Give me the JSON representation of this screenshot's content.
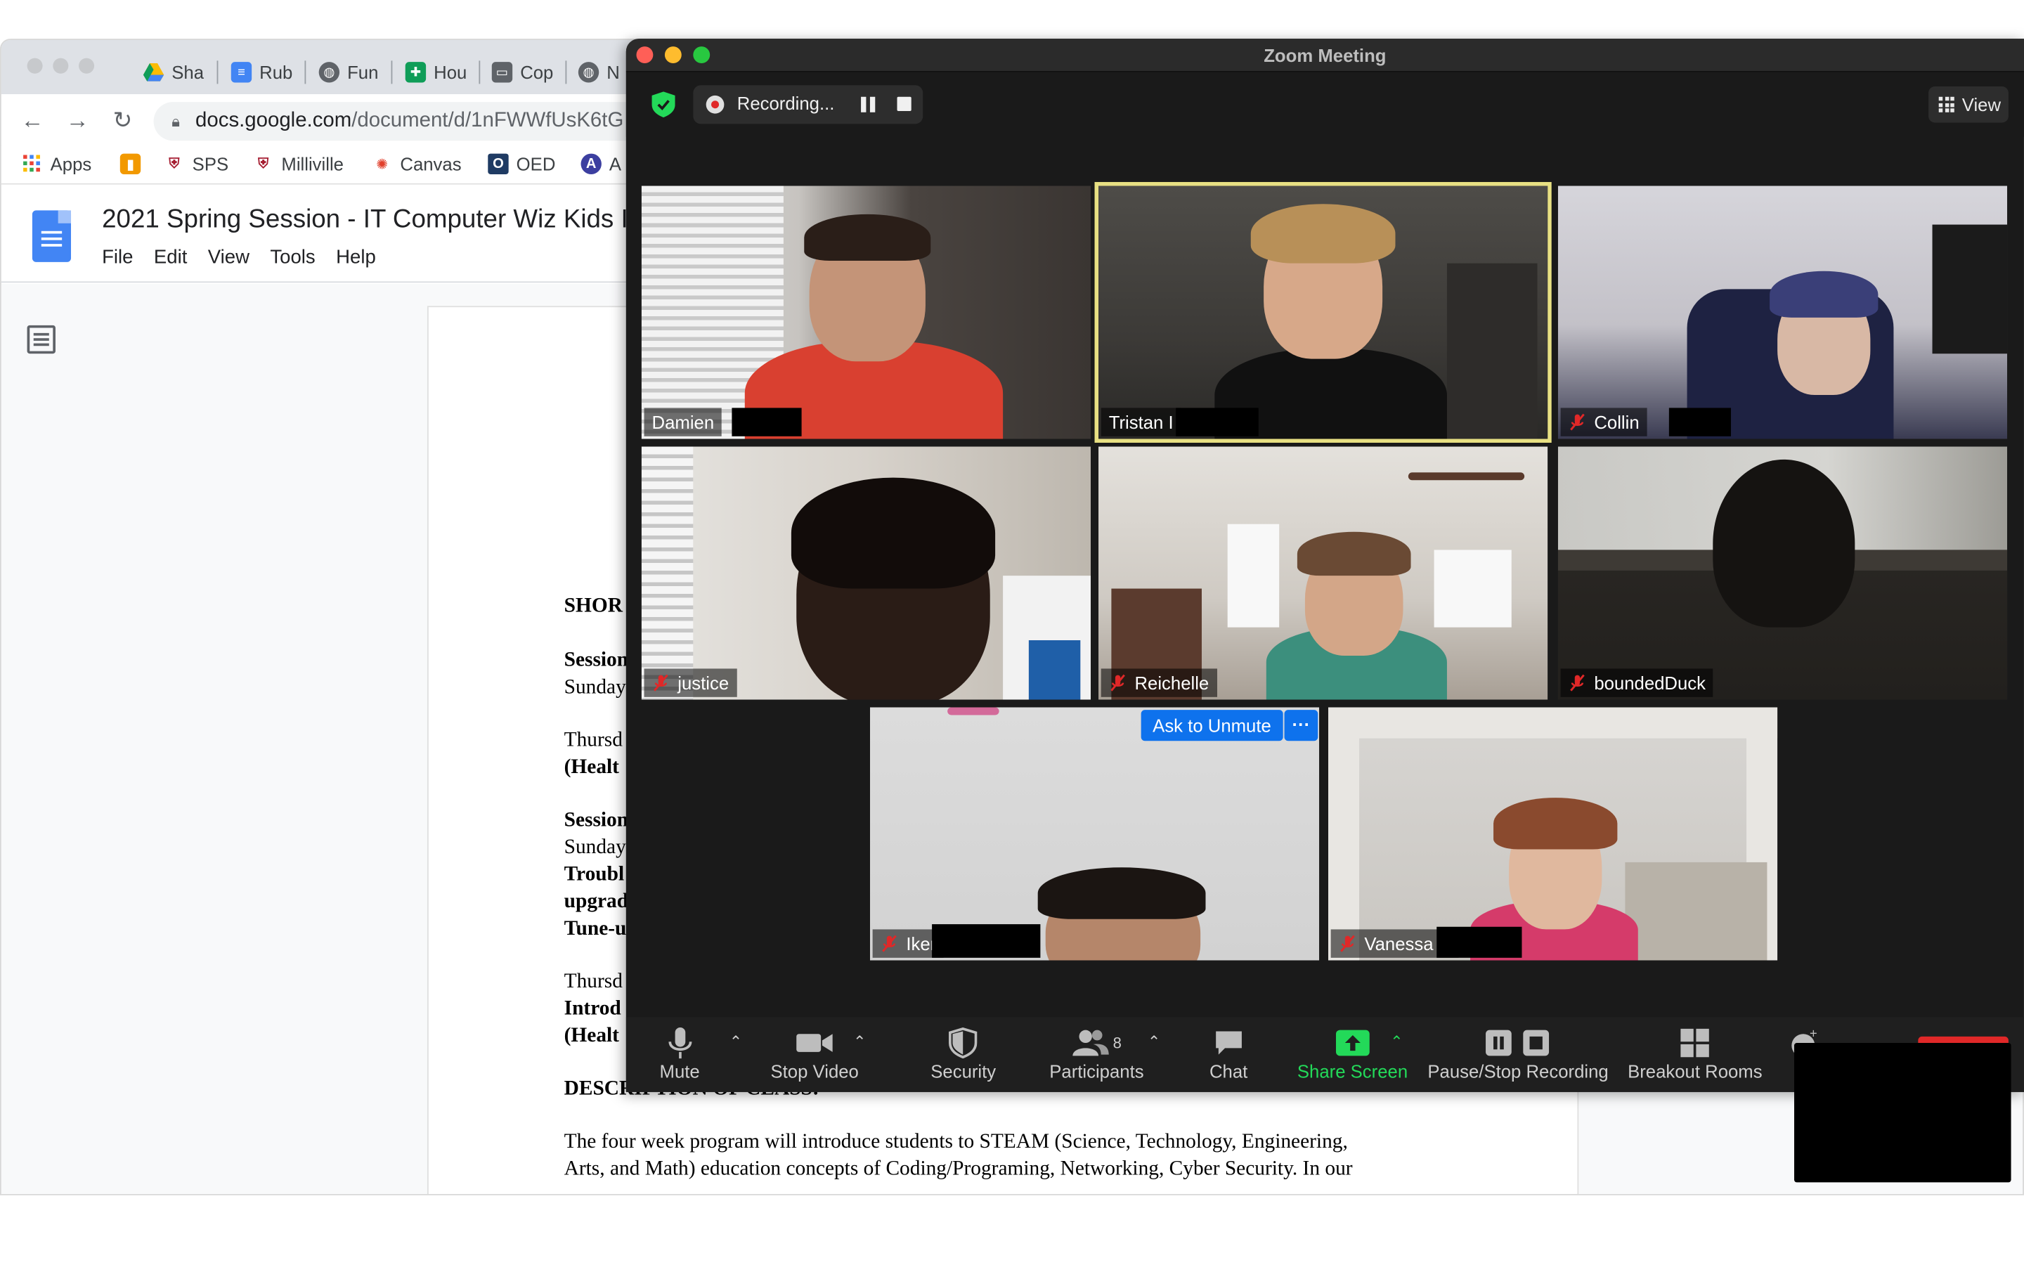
{
  "chrome": {
    "tabs": [
      {
        "label": "Sha",
        "icon": "google-drive-icon",
        "color": "#fbbc04"
      },
      {
        "label": "Rub",
        "icon": "google-docs-icon",
        "color": "#4285f4"
      },
      {
        "label": "Fun",
        "icon": "globe-icon",
        "color": "#5f6368"
      },
      {
        "label": "Hou",
        "icon": "google-sheets-icon",
        "color": "#0f9d58"
      },
      {
        "label": "Cop",
        "icon": "folder-icon",
        "color": "#5f6368"
      },
      {
        "label": "N",
        "icon": "globe-icon",
        "color": "#5f6368"
      }
    ],
    "url_host": "docs.google.com",
    "url_path": "/document/d/1nFWWfUsK6tG",
    "bookmarks": [
      {
        "label": "Apps",
        "icon": "apps-grid-icon"
      },
      {
        "label": "",
        "icon": "bookmark-orange-icon"
      },
      {
        "label": "SPS",
        "icon": "shield-crest-icon"
      },
      {
        "label": "Milliville",
        "icon": "shield-crest-icon"
      },
      {
        "label": "Canvas",
        "icon": "canvas-icon"
      },
      {
        "label": "OED",
        "icon": "oed-icon"
      },
      {
        "label": "A",
        "icon": "a-circle-icon"
      }
    ]
  },
  "docs": {
    "title": "2021 Spring Session - IT Computer  Wiz Kids  In",
    "menu": [
      "File",
      "Edit",
      "View",
      "Tools",
      "Help"
    ],
    "lines": [
      {
        "text": "SHOR",
        "bold": true
      },
      {
        "text": "Session",
        "bold": true
      },
      {
        "text": "Sunday",
        "bold": false
      },
      {
        "text": "Thursd",
        "bold": false
      },
      {
        "text": "(Healt",
        "bold": true
      },
      {
        "text": "Session",
        "bold": true
      },
      {
        "text": "Sunday",
        "bold": false
      },
      {
        "text": "Troubl",
        "bold": true
      },
      {
        "text": "upgrad",
        "bold": true
      },
      {
        "text": "Tune-u",
        "bold": true
      },
      {
        "text": "Thursd",
        "bold": false
      },
      {
        "text": "Introd",
        "bold": true
      },
      {
        "text": "(Healt",
        "bold": true
      }
    ],
    "description_heading": "DESCRIPTION OF CLASS:",
    "description_line1": "The four week program will introduce students to STEAM (Science, Technology, Engineering,",
    "description_line2": "Arts, and Math) education concepts of Coding/Programing, Networking, Cyber Security. In our"
  },
  "zoom": {
    "window_title": "Zoom Meeting",
    "recording_label": "Recording...",
    "view_label": "View",
    "ask_to_unmute": "Ask to Unmute",
    "more_label": "···",
    "participants": [
      {
        "name": "Damien",
        "muted": false,
        "active": false
      },
      {
        "name": "Tristan I",
        "muted": false,
        "active": true
      },
      {
        "name": "Collin",
        "muted": true,
        "active": false
      },
      {
        "name": "justice",
        "muted": true,
        "active": false
      },
      {
        "name": "Reichelle",
        "muted": true,
        "active": false
      },
      {
        "name": "boundedDuck",
        "muted": true,
        "active": false
      },
      {
        "name": "Iker",
        "muted": true,
        "active": false
      },
      {
        "name": "Vanessa S",
        "muted": true,
        "active": false
      }
    ],
    "toolbar": {
      "mute": "Mute",
      "stop_video": "Stop Video",
      "security": "Security",
      "participants": "Participants",
      "participants_count": "8",
      "chat": "Chat",
      "share_screen": "Share Screen",
      "pause_stop_recording": "Pause/Stop Recording",
      "breakout_rooms": "Breakout Rooms",
      "reactions_partial": "R"
    },
    "colors": {
      "active_speaker_border": "#e8e083",
      "ask_unmute_blue": "#0e72ed",
      "share_green": "#23d959",
      "muted_red": "#e02828"
    }
  }
}
